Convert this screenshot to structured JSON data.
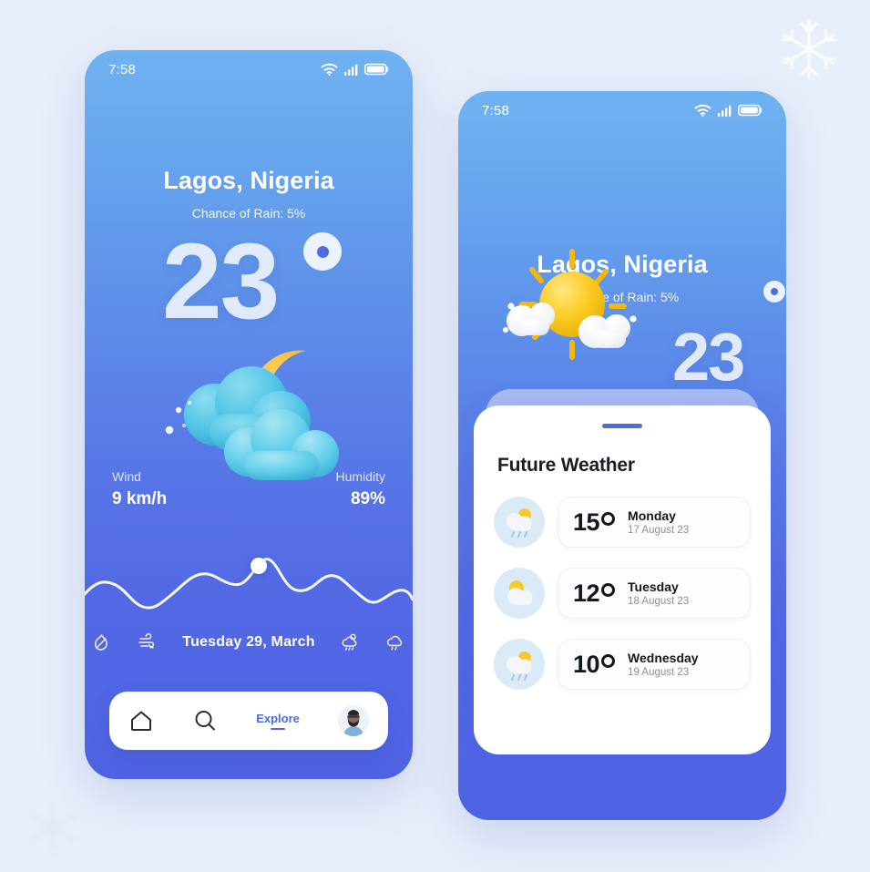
{
  "canvas": {
    "background": "#e8eefa"
  },
  "decorations": [
    {
      "name": "snowflake-top-right",
      "color": "#ffffff"
    },
    {
      "name": "snowflake-bottom-left",
      "color": "#dfe6f4"
    }
  ],
  "phone_1": {
    "status": {
      "time": "7:58",
      "icons": [
        "wifi-icon",
        "signal-icon",
        "battery-icon"
      ]
    },
    "city": "Lagos, Nigeria",
    "rain": "Chance of Rain: 5%",
    "temperature": "23",
    "degree_symbol": "°",
    "weather_art": "moon-clouds-night-icon",
    "metrics": [
      {
        "label": "Wind",
        "value": "9 km/h"
      },
      {
        "label": "Humidity",
        "value": "89%"
      }
    ],
    "date": "Tuesday 29, March",
    "date_icons_left": [
      "fire-outline-icon",
      "wind-outline-icon"
    ],
    "date_icons_right": [
      "sun-cloud-rain-outline-icon",
      "cloud-rain-outline-icon"
    ],
    "nav": {
      "home_label": "home-icon",
      "search_label": "search-icon",
      "explore_label": "Explore",
      "avatar_label": "avatar"
    },
    "accent": "#4F6BE0"
  },
  "phone_2": {
    "status": {
      "time": "7:58",
      "icons": [
        "wifi-icon",
        "signal-icon",
        "battery-icon"
      ]
    },
    "city": "Lagos, Nigeria",
    "rain": "Chance of Rain: 5%",
    "temperature": "23",
    "degree_symbol": "°",
    "weather_art": "sun-clouds-day-icon",
    "sheet": {
      "title": "Future Weather",
      "handle": "drag-handle",
      "forecast": [
        {
          "icon": "sun-cloud-rain-icon",
          "temp": "15",
          "day": "Monday",
          "date": "17 August 23"
        },
        {
          "icon": "sun-cloud-icon",
          "temp": "12",
          "day": "Tuesday",
          "date": "18 August 23"
        },
        {
          "icon": "sun-cloud-rain-icon",
          "temp": "10",
          "day": "Wednesday",
          "date": "19 August 23"
        }
      ]
    },
    "accent": "#4F6BE0"
  }
}
